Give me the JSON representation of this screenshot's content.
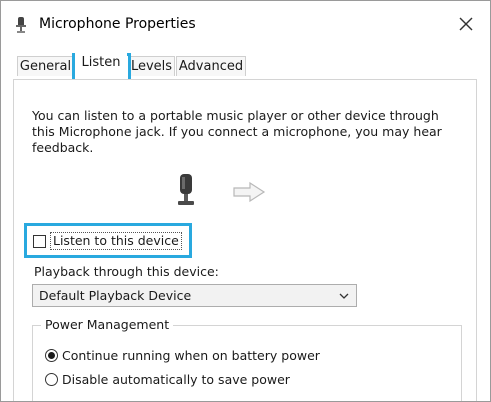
{
  "window": {
    "title": "Microphone Properties"
  },
  "tabs": [
    {
      "label": "General",
      "active": false
    },
    {
      "label": "Listen",
      "active": true
    },
    {
      "label": "Levels",
      "active": false
    },
    {
      "label": "Advanced",
      "active": false
    }
  ],
  "listen": {
    "description": "You can listen to a portable music player or other device through this Microphone jack.  If you connect a microphone, you may hear feedback.",
    "listen_checkbox": {
      "label": "Listen to this device",
      "checked": false
    },
    "playback_label": "Playback through this device:",
    "playback_device": {
      "selected": "Default Playback Device"
    }
  },
  "power": {
    "title": "Power Management",
    "options": [
      {
        "label": "Continue running when on battery power",
        "selected": true
      },
      {
        "label": "Disable automatically to save power",
        "selected": false
      }
    ]
  },
  "icons": {
    "title": "microphone-icon",
    "close": "close-icon",
    "device": "microphone-icon",
    "flow": "arrow-right-icon",
    "dropdown": "chevron-down-icon"
  },
  "colors": {
    "highlight": "#29a9df",
    "panel_border": "#d4d4d4"
  }
}
